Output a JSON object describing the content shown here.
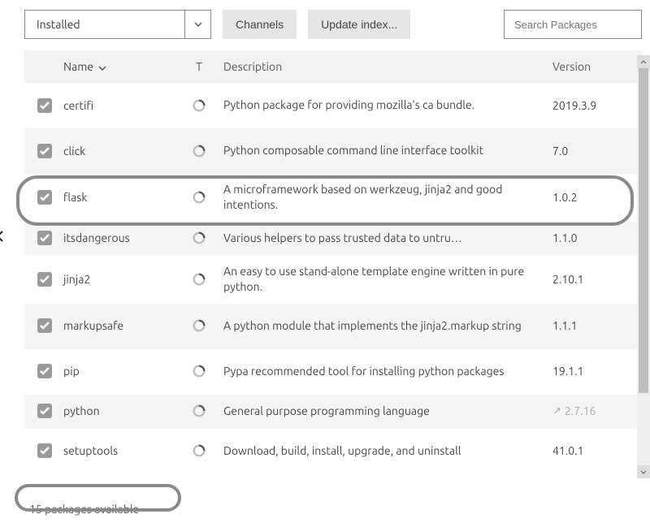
{
  "toolbar": {
    "filter_label": "Installed",
    "channels_label": "Channels",
    "update_index_label": "Update index...",
    "search_placeholder": "Search Packages"
  },
  "columns": {
    "name": "Name",
    "t": "T",
    "description": "Description",
    "version": "Version"
  },
  "packages": [
    {
      "name": "certifi",
      "description": "Python package for providing mozilla's ca bundle.",
      "version": "2019.3.9",
      "alt": false,
      "single": false
    },
    {
      "name": "click",
      "description": "Python composable command line interface toolkit",
      "version": "7.0",
      "alt": true,
      "single": false
    },
    {
      "name": "flask",
      "description": "A microframework based on werkzeug, jinja2 and good intentions.",
      "version": "1.0.2",
      "alt": false,
      "single": false
    },
    {
      "name": "itsdangerous",
      "description": "Various helpers to pass trusted data to untru…",
      "version": "1.1.0",
      "alt": true,
      "single": true
    },
    {
      "name": "jinja2",
      "description": "An easy to use stand-alone template engine written in pure python.",
      "version": "2.10.1",
      "alt": false,
      "single": false
    },
    {
      "name": "markupsafe",
      "description": "A python module that implements the jinja2.markup string",
      "version": "1.1.1",
      "alt": true,
      "single": false
    },
    {
      "name": "pip",
      "description": "Pypa recommended tool for installing python packages",
      "version": "19.1.1",
      "alt": false,
      "single": false
    },
    {
      "name": "python",
      "description": "General purpose programming language",
      "version": "2.7.16",
      "alt": true,
      "single": true,
      "upgrade": true
    },
    {
      "name": "setuptools",
      "description": "Download, build, install, upgrade, and uninstall",
      "version": "41.0.1",
      "alt": false,
      "single": false
    }
  ],
  "footer": {
    "available_text": "15 packages available"
  }
}
